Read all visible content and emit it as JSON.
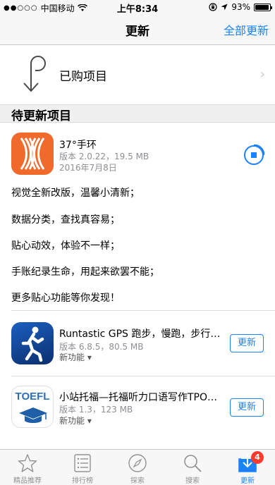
{
  "status_bar": {
    "carrier": "中国移动",
    "time": "上午8:34",
    "battery": "93%",
    "battery_level": 0.93,
    "signal_icon": "signal-dots-icon",
    "wifi_icon": "wifi-icon",
    "lock_icon": "rotation-lock-icon",
    "location_icon": "location-arrow-icon"
  },
  "nav": {
    "title": "更新",
    "action": "全部更新"
  },
  "purchased": {
    "label": "已购项目",
    "chevron": "›",
    "icon": "purchased-arrow-icon"
  },
  "section": {
    "title": "待更新项目"
  },
  "apps": [
    {
      "name": "37°手环",
      "version": "版本 2.0.22，19.5 MB",
      "date": "2016年7月8日",
      "state": "downloading",
      "icon": "37-bracelet-app-icon",
      "notes": [
        "视觉全新改版，温馨小清新；",
        "数据分类，查找真容易；",
        "贴心动效，体验不一样；",
        "手账纪录生命，用起来欲罢不能；",
        "更多贴心功能等你发现！"
      ]
    },
    {
      "name": "Runtastic GPS 跑步，慢跑，步行…",
      "version": "版本 6.8.5，80.5 MB",
      "features": "新功能 ▾",
      "button": "更新",
      "icon": "runtastic-app-icon"
    },
    {
      "name": "小站托福—托福听力口语写作TPO…",
      "version": "版本 1.3，123 MB",
      "features": "新功能 ▾",
      "button": "更新",
      "icon": "toefl-app-icon",
      "icon_text": "TOEFL"
    }
  ],
  "tabs": [
    {
      "label": "精品推荐",
      "icon": "star-icon"
    },
    {
      "label": "排行榜",
      "icon": "list-icon"
    },
    {
      "label": "探索",
      "icon": "compass-icon"
    },
    {
      "label": "搜索",
      "icon": "search-icon"
    },
    {
      "label": "更新",
      "icon": "download-icon",
      "badge": "4",
      "active": true
    }
  ],
  "colors": {
    "accent": "#1a82fb",
    "badge": "#ff3b30",
    "app1_orange": "#f06a2c",
    "app2_blue": "#0b3d8c"
  }
}
